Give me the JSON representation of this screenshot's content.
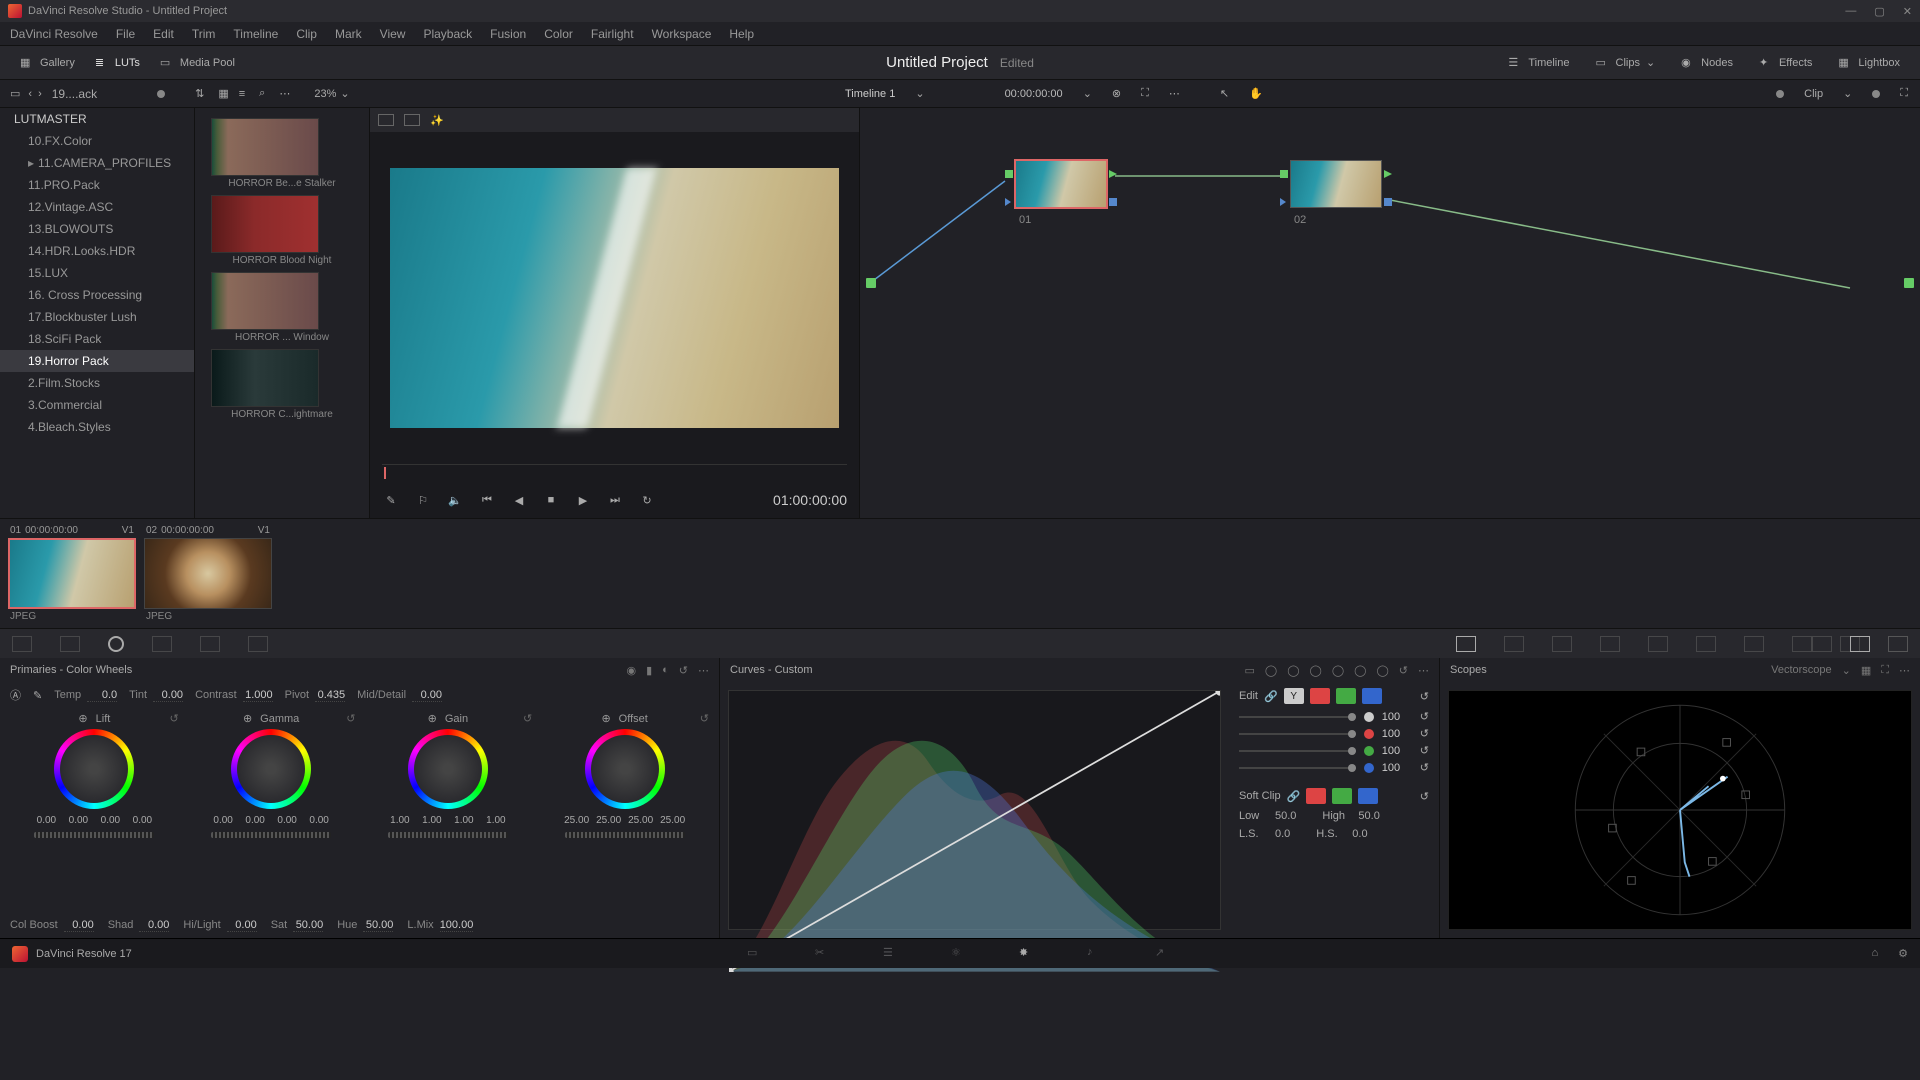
{
  "window": {
    "title": "DaVinci Resolve Studio - Untitled Project"
  },
  "menu": [
    "DaVinci Resolve",
    "File",
    "Edit",
    "Trim",
    "Timeline",
    "Clip",
    "Mark",
    "View",
    "Playback",
    "Fusion",
    "Color",
    "Fairlight",
    "Workspace",
    "Help"
  ],
  "toolbar": {
    "gallery": "Gallery",
    "luts": "LUTs",
    "mediapool": "Media Pool",
    "project": "Untitled Project",
    "edited": "Edited",
    "timeline": "Timeline",
    "clips": "Clips",
    "nodes": "Nodes",
    "effects": "Effects",
    "lightbox": "Lightbox"
  },
  "subbar": {
    "crumb": "19....ack",
    "zoom": "23%",
    "timeline": "Timeline 1",
    "timecode": "00:00:00:00",
    "clip": "Clip"
  },
  "lut_tree": [
    {
      "label": "LUTMASTER",
      "root": true
    },
    {
      "label": "10.FX.Color"
    },
    {
      "label": "11.CAMERA_PROFILES",
      "expandable": true
    },
    {
      "label": "11.PRO.Pack"
    },
    {
      "label": "12.Vintage.ASC"
    },
    {
      "label": "13.BLOWOUTS"
    },
    {
      "label": "14.HDR.Looks.HDR"
    },
    {
      "label": "15.LUX"
    },
    {
      "label": "16. Cross Processing"
    },
    {
      "label": "17.Blockbuster Lush"
    },
    {
      "label": "18.SciFi Pack"
    },
    {
      "label": "19.Horror Pack",
      "active": true
    },
    {
      "label": "2.Film.Stocks"
    },
    {
      "label": "3.Commercial"
    },
    {
      "label": "4.Bleach.Styles"
    }
  ],
  "lut_thumbs": [
    {
      "label": "HORROR Be...e Stalker",
      "cls": ""
    },
    {
      "label": "HORROR Blood Night",
      "cls": "red"
    },
    {
      "label": "HORROR ... Window",
      "cls": ""
    },
    {
      "label": "HORROR C...ightmare",
      "cls": "dark"
    }
  ],
  "viewer": {
    "timecode": "01:00:00:00"
  },
  "nodes": {
    "n1": "01",
    "n2": "02"
  },
  "clips": [
    {
      "idx": "01",
      "tc": "00:00:00:00",
      "track": "V1",
      "type": "JPEG",
      "cls": "beach",
      "sel": true
    },
    {
      "idx": "02",
      "tc": "00:00:00:00",
      "track": "V1",
      "type": "JPEG",
      "cls": "coffee",
      "sel": false
    }
  ],
  "primaries": {
    "title": "Primaries - Color Wheels",
    "globals": {
      "temp_l": "Temp",
      "temp": "0.0",
      "tint_l": "Tint",
      "tint": "0.00",
      "contrast_l": "Contrast",
      "contrast": "1.000",
      "pivot_l": "Pivot",
      "pivot": "0.435",
      "md_l": "Mid/Detail",
      "md": "0.00"
    },
    "wheels": {
      "lift": {
        "name": "Lift",
        "v": [
          "0.00",
          "0.00",
          "0.00",
          "0.00"
        ]
      },
      "gamma": {
        "name": "Gamma",
        "v": [
          "0.00",
          "0.00",
          "0.00",
          "0.00"
        ]
      },
      "gain": {
        "name": "Gain",
        "v": [
          "1.00",
          "1.00",
          "1.00",
          "1.00"
        ]
      },
      "offset": {
        "name": "Offset",
        "v": [
          "25.00",
          "25.00",
          "25.00",
          "25.00"
        ]
      }
    },
    "bottom": {
      "colboost_l": "Col Boost",
      "colboost": "0.00",
      "shad_l": "Shad",
      "shad": "0.00",
      "hl_l": "Hi/Light",
      "hl": "0.00",
      "sat_l": "Sat",
      "sat": "50.00",
      "hue_l": "Hue",
      "hue": "50.00",
      "lmix_l": "L.Mix",
      "lmix": "100.00"
    }
  },
  "curves": {
    "title": "Curves - Custom",
    "edit": "Edit",
    "softclip": "Soft Clip",
    "intensity": {
      "y": "100",
      "r": "100",
      "g": "100",
      "b": "100"
    },
    "low_l": "Low",
    "low": "50.0",
    "high_l": "High",
    "high": "50.0",
    "ls_l": "L.S.",
    "ls": "0.0",
    "hs_l": "H.S.",
    "hs": "0.0"
  },
  "scopes": {
    "title": "Scopes",
    "type": "Vectorscope"
  },
  "footer": {
    "app": "DaVinci Resolve 17"
  }
}
